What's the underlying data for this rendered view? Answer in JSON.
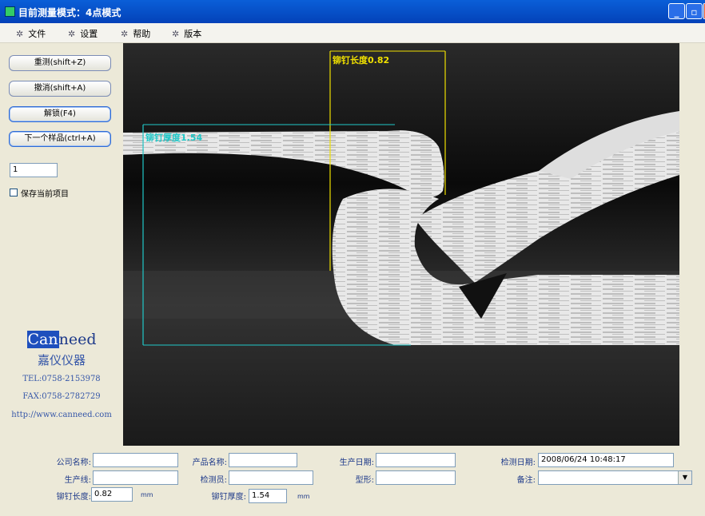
{
  "window": {
    "title": "目前测量模式：4点模式"
  },
  "menu": [
    {
      "label": "文件"
    },
    {
      "label": "设置"
    },
    {
      "label": "帮助"
    },
    {
      "label": "版本"
    }
  ],
  "sidebar": {
    "buttons": [
      {
        "label": "重测(shift+Z)"
      },
      {
        "label": "撤消(shift+A)"
      },
      {
        "label": "解锁(F4)"
      },
      {
        "label": "下一个样品(ctrl+A)"
      }
    ],
    "sample_number": "1",
    "save_checkbox": {
      "label": "保存当前项目",
      "checked": false
    }
  },
  "brand": {
    "logo_part1": "Can",
    "logo_part2": "need",
    "chinese_name": "嘉仪仪器",
    "tel": "TEL:0758-2153978",
    "fax": "FAX:0758-2782729",
    "url": "http://www.canneed.com"
  },
  "viewer": {
    "annotation_length": "铆钉长度0.82",
    "annotation_thickness": "铆钉厚度1.54"
  },
  "form": {
    "company_label": "公司名称:",
    "company_value": "",
    "product_label": "产品名称:",
    "product_value": "",
    "prod_date_label": "生产日期:",
    "prod_date_value": "",
    "inspect_date_label": "检测日期:",
    "inspect_date_value": "2008/06/24 10:48:17",
    "line_label": "生产线:",
    "line_value": "",
    "inspector_label": "检测员:",
    "inspector_value": "",
    "shape_label": "型形:",
    "shape_value": "",
    "remark_label": "备注:",
    "remark_value": "",
    "rivet_length_label": "铆钉长度:",
    "rivet_length_value": "0.82",
    "rivet_length_unit": "mm",
    "rivet_thickness_label": "铆钉厚度:",
    "rivet_thickness_value": "1.54",
    "rivet_thickness_unit": "mm"
  },
  "colors": {
    "titlebar": "#0a5fd8",
    "annotation_length": "#f0e000",
    "annotation_thickness": "#20c8c8",
    "brand_blue": "#1e3a8a",
    "label_blue": "#1e3a8a"
  }
}
